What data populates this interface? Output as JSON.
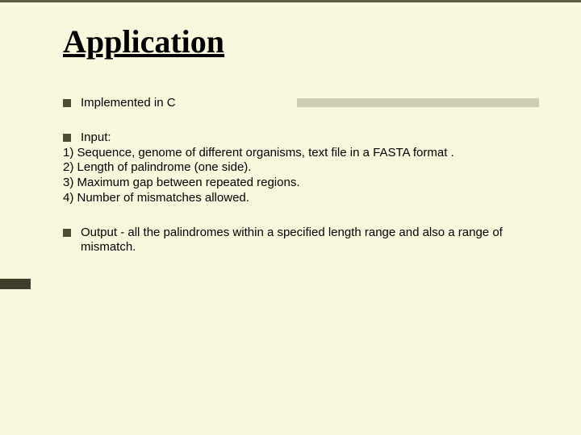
{
  "title": "Application",
  "bullets": {
    "b1": "Implemented in C",
    "b2_head": "Input:",
    "b2_lines": {
      "l1": "1) Sequence, genome of different organisms, text file in a FASTA format .",
      "l2": "2) Length of palindrome (one side).",
      "l3": "3) Maximum gap between repeated regions.",
      "l4": "4) Number of mismatches allowed."
    },
    "b3": "Output - all the palindromes within a specified length range and also a range of mismatch."
  }
}
